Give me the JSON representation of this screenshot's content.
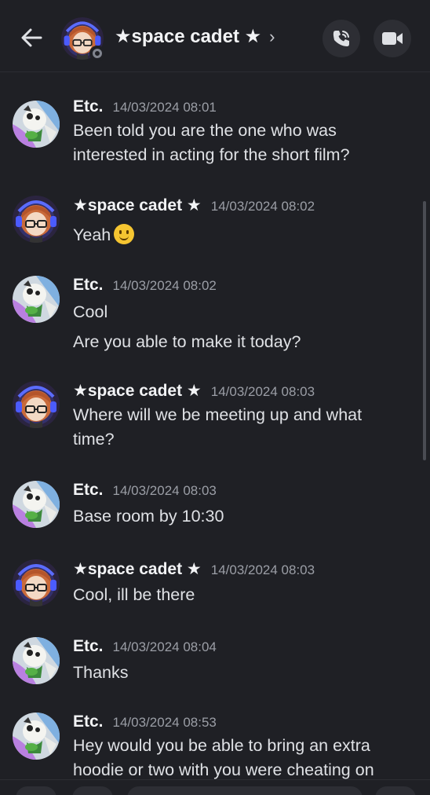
{
  "header": {
    "title": "★space cadet ★",
    "chevron": "›",
    "back_icon": "arrow-left-icon",
    "call_icon": "phone-call-icon",
    "video_icon": "video-camera-icon"
  },
  "messages": [
    {
      "author": "Etc.",
      "time": "14/03/2024 08:01",
      "lines": [
        "Been told you are the one who was",
        "interested in acting for the short film?"
      ]
    },
    {
      "author": "★space cadet ★",
      "time": "14/03/2024 08:02",
      "lines": [
        "Yeah"
      ],
      "emoji": "slightly-smiling-face"
    },
    {
      "author": "Etc.",
      "time": "14/03/2024 08:02",
      "lines": [
        "Cool",
        "Are you able to make it today?"
      ]
    },
    {
      "author": "★space cadet ★",
      "time": "14/03/2024 08:03",
      "lines": [
        "Where will we be meeting up and what",
        "time?"
      ]
    },
    {
      "author": "Etc.",
      "time": "14/03/2024 08:03",
      "lines": [
        "Base room by 10:30"
      ]
    },
    {
      "author": "★space cadet ★",
      "time": "14/03/2024 08:03",
      "lines": [
        "Cool, ill be there"
      ]
    },
    {
      "author": "Etc.",
      "time": "14/03/2024 08:04",
      "lines": [
        "Thanks"
      ]
    },
    {
      "author": "Etc.",
      "time": "14/03/2024 08:53",
      "lines": [
        "Hey would you be able to bring an extra",
        "hoodie or two with you were cheating on"
      ]
    }
  ],
  "colors": {
    "background": "#1f2025",
    "status_offline": "#80848e",
    "timestamp": "#9b9ea6"
  }
}
